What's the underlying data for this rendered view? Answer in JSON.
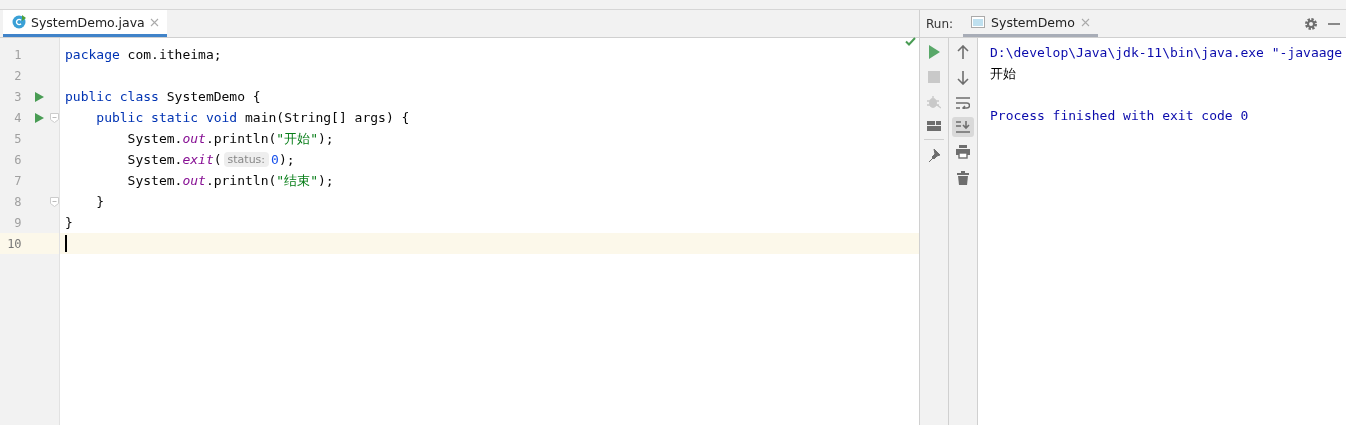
{
  "editor_tabs": [
    {
      "label": "SystemDemo.java",
      "selected": true
    }
  ],
  "editor": {
    "analysis_ok": true,
    "lines": [
      {
        "number": "1",
        "run_marker": false,
        "fold_marker": false,
        "current": false,
        "tokens": [
          {
            "kind": "keyword",
            "text": "package"
          },
          {
            "kind": "plain",
            "text": " com.itheima;"
          }
        ]
      },
      {
        "number": "2",
        "run_marker": false,
        "fold_marker": false,
        "current": false
      },
      {
        "number": "3",
        "run_marker": true,
        "fold_marker": false,
        "current": false,
        "tokens": [
          {
            "kind": "keyword",
            "text": "public class"
          },
          {
            "kind": "plain",
            "text": " SystemDemo {"
          }
        ]
      },
      {
        "number": "4",
        "run_marker": true,
        "fold_marker": true,
        "current": false,
        "tokens": [
          {
            "kind": "keyword",
            "text": "    public static void"
          },
          {
            "kind": "plain",
            "text": " main(String[] args) {"
          }
        ]
      },
      {
        "number": "5",
        "run_marker": false,
        "fold_marker": false,
        "current": false,
        "tokens": [
          {
            "kind": "plain",
            "text": "        System."
          },
          {
            "kind": "field",
            "text": "out"
          },
          {
            "kind": "plain",
            "text": ".println("
          },
          {
            "kind": "string",
            "text": "\"开始\""
          },
          {
            "kind": "plain",
            "text": ");"
          }
        ]
      },
      {
        "number": "6",
        "run_marker": false,
        "fold_marker": false,
        "current": false,
        "tokens": [
          {
            "kind": "plain",
            "text": "        System."
          },
          {
            "kind": "field",
            "text": "exit"
          },
          {
            "kind": "plain",
            "text": "("
          },
          {
            "kind": "hint",
            "text": "status:"
          },
          {
            "kind": "number",
            "text": "0"
          },
          {
            "kind": "plain",
            "text": ");"
          }
        ]
      },
      {
        "number": "7",
        "run_marker": false,
        "fold_marker": false,
        "current": false,
        "tokens": [
          {
            "kind": "plain",
            "text": "        System."
          },
          {
            "kind": "field",
            "text": "out"
          },
          {
            "kind": "plain",
            "text": ".println("
          },
          {
            "kind": "string",
            "text": "\"结束\""
          },
          {
            "kind": "plain",
            "text": ");"
          }
        ]
      },
      {
        "number": "8",
        "run_marker": false,
        "fold_marker": true,
        "current": false,
        "tokens": [
          {
            "kind": "plain",
            "text": "    }"
          }
        ]
      },
      {
        "number": "9",
        "run_marker": false,
        "fold_marker": false,
        "current": false,
        "tokens": [
          {
            "kind": "plain",
            "text": "}"
          }
        ]
      },
      {
        "number": "10",
        "run_marker": false,
        "fold_marker": false,
        "current": true
      }
    ]
  },
  "run_panel": {
    "label": "Run:",
    "tabs": [
      {
        "label": "SystemDemo",
        "selected": true
      }
    ],
    "console": [
      {
        "kind": "command",
        "text": "D:\\develop\\Java\\jdk-11\\bin\\java.exe \"-javaage"
      },
      {
        "kind": "output",
        "text": "开始"
      },
      {
        "kind": "blank"
      },
      {
        "kind": "system",
        "text": "Process finished with exit code 0"
      }
    ]
  }
}
